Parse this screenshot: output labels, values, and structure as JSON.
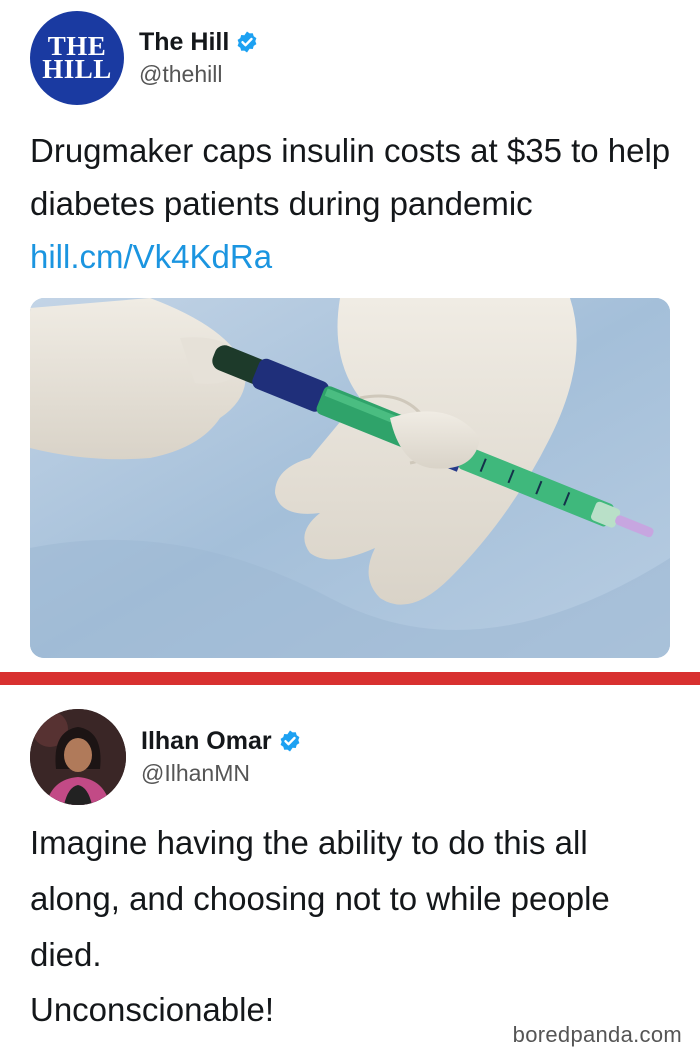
{
  "top_tweet": {
    "display_name": "The Hill",
    "handle": "@thehill",
    "avatar_text_line1": "THE",
    "avatar_text_line2": "HILL",
    "text": "Drugmaker caps insulin costs at $35 to help diabetes patients during pandemic ",
    "link": "hill.cm/Vk4KdRa",
    "media_icon": "insulin-pen-photo"
  },
  "bottom_tweet": {
    "display_name": "Ilhan Omar",
    "handle": "@IlhanMN",
    "text": "Imagine having the ability to do this all along, and choosing not to while people died.",
    "text2": "Unconscionable!"
  },
  "watermark": "boredpanda.com",
  "colors": {
    "divider": "#d8302f",
    "link": "#1b95e0",
    "verified": "#1da1f2",
    "hill_avatar": "#1a3aa1"
  }
}
